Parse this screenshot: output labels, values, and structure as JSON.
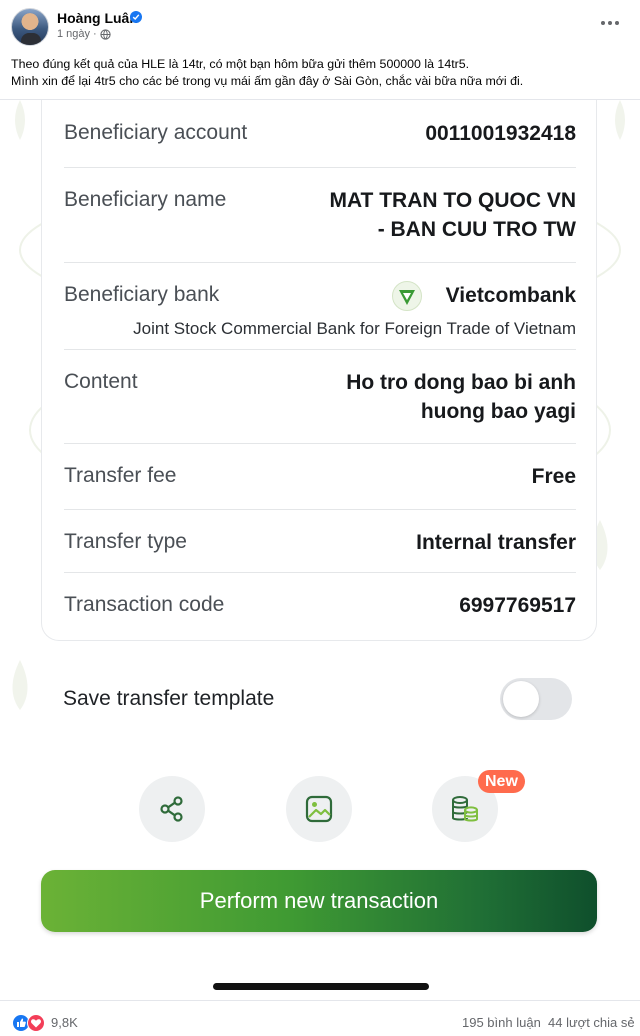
{
  "post": {
    "author": "Hoàng Luân",
    "time": "1 ngày",
    "separator": "·",
    "text_lines": [
      "Theo đúng kết quả của HLE là 14tr, có một bạn hôm bữa gửi thêm 500000 là 14tr5.",
      "Mình xin để lại 4tr5 cho các bé trong vụ mái ấm gần đây ở Sài Gòn, chắc vài bữa nữa mới đi."
    ]
  },
  "transfer": {
    "rows": [
      {
        "label": "Beneficiary account",
        "value": "0011001932418"
      },
      {
        "label": "Beneficiary name",
        "value_lines": [
          "MAT TRAN TO QUOC VN",
          "- BAN CUU TRO TW"
        ]
      },
      {
        "label": "Beneficiary bank",
        "value": "Vietcombank",
        "sub_value": "Joint Stock Commercial Bank for Foreign Trade of Vietnam",
        "icon": "vietcombank-logo-icon"
      },
      {
        "label": "Content",
        "value_lines": [
          "Ho tro dong bao bi anh",
          "huong bao yagi"
        ]
      },
      {
        "label": "Transfer fee",
        "value": "Free"
      },
      {
        "label": "Transfer type",
        "value": "Internal transfer"
      },
      {
        "label": "Transaction code",
        "value": "6997769517"
      }
    ],
    "save_template_label": "Save transfer template",
    "save_template_enabled": false,
    "actions": [
      {
        "icon": "share-icon"
      },
      {
        "icon": "image-icon"
      },
      {
        "icon": "coins-icon",
        "badge": "New"
      }
    ],
    "primary_button_label": "Perform new transaction"
  },
  "footer": {
    "reactions": [
      "like-icon",
      "heart-icon"
    ],
    "reaction_count": "9,8K",
    "comments": "195 bình luận",
    "shares": "44 lượt chia sẻ"
  },
  "colors": {
    "facebook_blue": "#1877f2",
    "vcb_green": "#3f9a33",
    "badge_orange": "#ff6b4d"
  }
}
